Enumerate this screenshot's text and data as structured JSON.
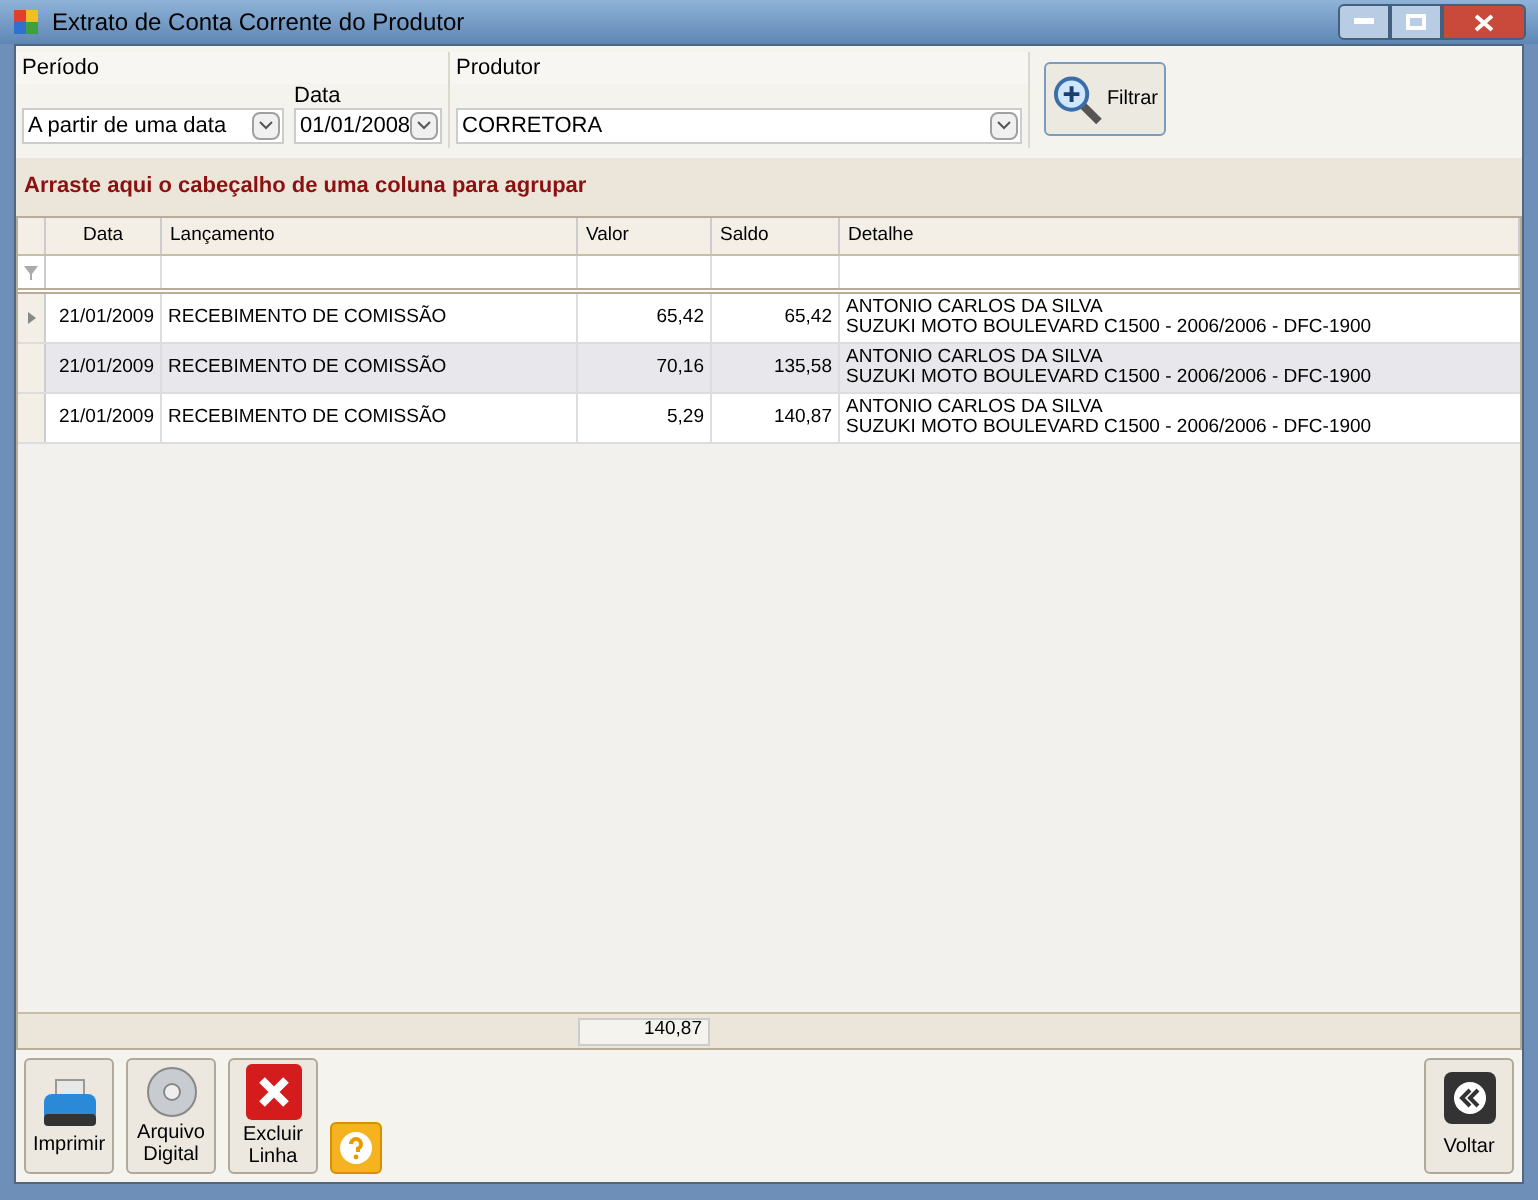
{
  "window": {
    "title": "Extrato de Conta Corrente do Produtor"
  },
  "filters": {
    "period_label": "Período",
    "period_value": "A partir de uma data",
    "date_label": "Data",
    "date_value": "01/01/2008",
    "producer_label": "Produtor",
    "producer_value": "CORRETORA",
    "filter_button": "Filtrar"
  },
  "group_hint": "Arraste aqui o cabeçalho de uma coluna para agrupar",
  "table": {
    "columns": [
      "Data",
      "Lançamento",
      "Valor",
      "Saldo",
      "Detalhe"
    ],
    "rows": [
      {
        "selected": true,
        "highlighted": false,
        "cells": [
          "21/01/2009",
          "RECEBIMENTO DE COMISSÃO",
          "65,42",
          "65,42"
        ],
        "detail": [
          "ANTONIO CARLOS DA SILVA",
          "SUZUKI MOTO BOULEVARD C1500 - 2006/2006 - DFC-1900"
        ]
      },
      {
        "selected": false,
        "highlighted": true,
        "cells": [
          "21/01/2009",
          "RECEBIMENTO DE COMISSÃO",
          "70,16",
          "135,58"
        ],
        "detail": [
          "ANTONIO CARLOS DA SILVA",
          "SUZUKI MOTO BOULEVARD C1500 - 2006/2006 - DFC-1900"
        ]
      },
      {
        "selected": false,
        "highlighted": false,
        "cells": [
          "21/01/2009",
          "RECEBIMENTO DE COMISSÃO",
          "5,29",
          "140,87"
        ],
        "detail": [
          "ANTONIO CARLOS DA SILVA",
          "SUZUKI MOTO BOULEVARD C1500 - 2006/2006 - DFC-1900"
        ]
      }
    ],
    "total": "140,87"
  },
  "buttons": [
    {
      "kind": "print",
      "label": "Imprimir"
    },
    {
      "kind": "disc",
      "label": "Arquivo Digital"
    },
    {
      "kind": "delete",
      "label": "Excluir Linha"
    }
  ],
  "back_button": "Voltar"
}
